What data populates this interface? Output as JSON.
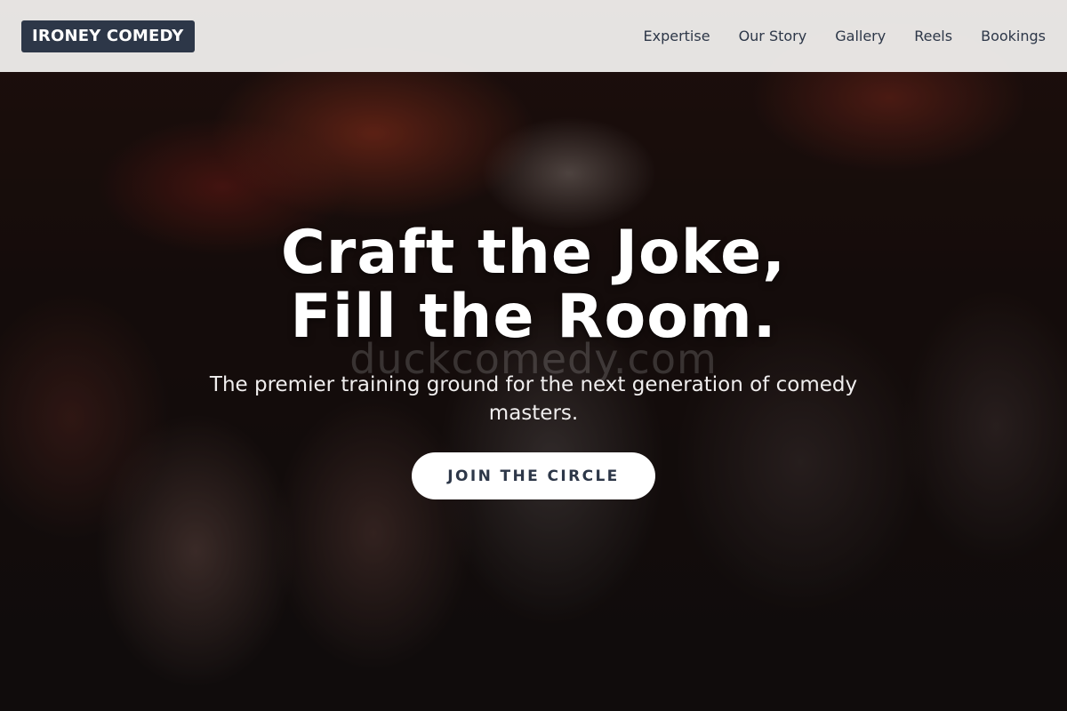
{
  "header": {
    "logo": "IRONEY COMEDY",
    "nav": [
      {
        "label": "Expertise"
      },
      {
        "label": "Our Story"
      },
      {
        "label": "Gallery"
      },
      {
        "label": "Reels"
      },
      {
        "label": "Bookings"
      }
    ]
  },
  "hero": {
    "title_line1": "Craft the Joke,",
    "title_line2": "Fill the Room.",
    "watermark": "duckcomedy.com",
    "subtitle": "The premier training ground for the next generation of comedy masters.",
    "cta_label": "JOIN THE CIRCLE"
  },
  "colors": {
    "logo_bg": "#2d3748",
    "nav_text": "#2d3748",
    "header_bg": "#eceae8",
    "cta_bg": "#ffffff",
    "cta_text": "#2d3748"
  }
}
